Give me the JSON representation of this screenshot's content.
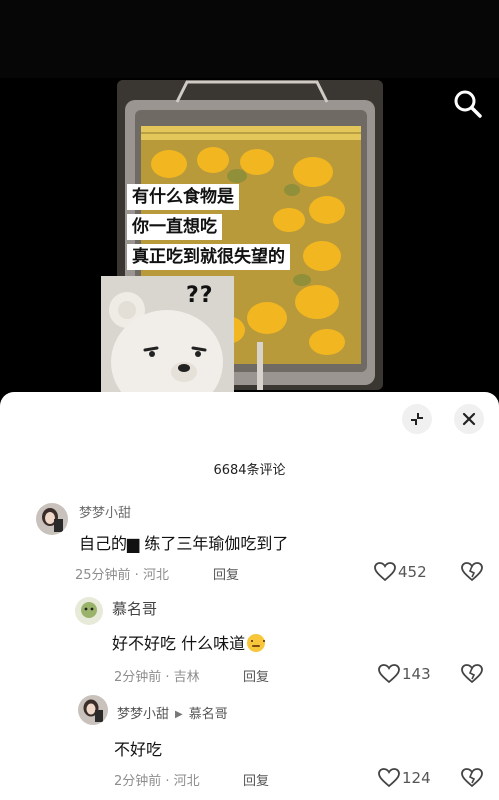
{
  "video": {
    "caption_lines": [
      "有什么食物是",
      "你一直想吃",
      "真正吃到就很失望的"
    ],
    "sticker_text": "??"
  },
  "sheet": {
    "comment_count": "6684条评论"
  },
  "comments": [
    {
      "username": "梦梦小甜",
      "text": "自己的▆ 练了三年瑜伽吃到了",
      "time": "25分钟前 · 河北",
      "reply_label": "回复",
      "likes": "452"
    },
    {
      "username": "慕名哥",
      "text": "好不好吃 什么味道",
      "time": "2分钟前 · 吉林",
      "reply_label": "回复",
      "likes": "143"
    },
    {
      "username": "梦梦小甜",
      "reply_to": "慕名哥",
      "text": "不好吃",
      "time": "2分钟前 · 河北",
      "reply_label": "回复",
      "likes": "124"
    }
  ],
  "icons": {
    "search": "search-icon",
    "collapse": "collapse-icon",
    "close": "close-icon",
    "like": "heart-icon",
    "dislike": "broken-heart-icon"
  }
}
